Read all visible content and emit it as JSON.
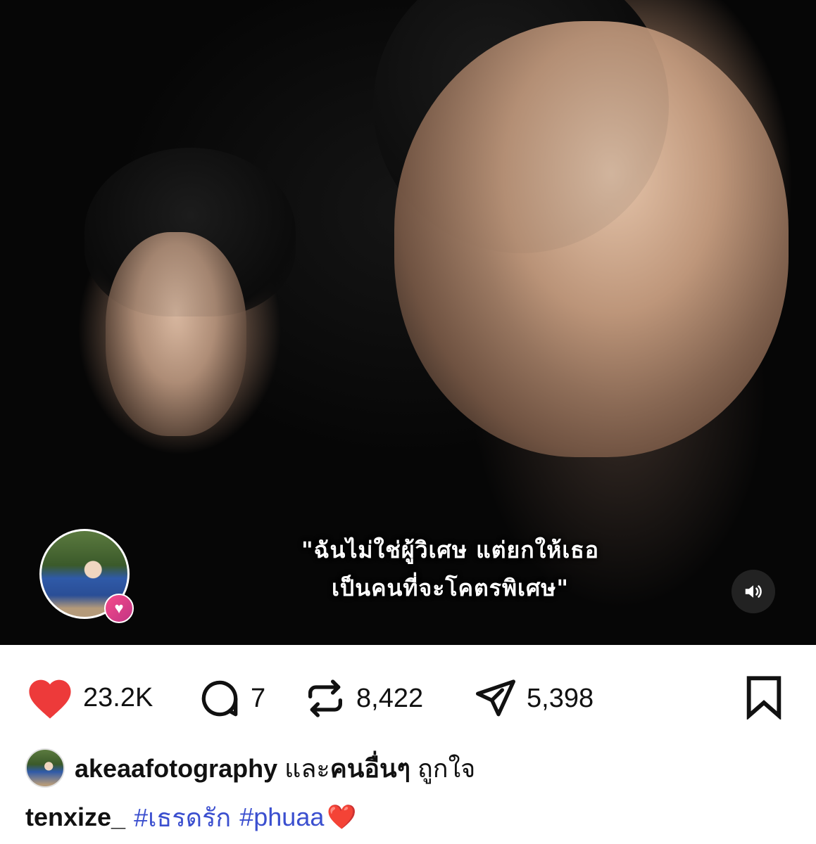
{
  "media": {
    "subtitle_line1": "\"ฉันไม่ใช่ผู้วิเศษ แต่ยกให้เธอ",
    "subtitle_line2": "เป็นคนที่จะโคตรพิเศษ\"",
    "sound_state": "unmuted"
  },
  "actions": {
    "likes": "23.2K",
    "comments": "7",
    "reposts": "8,422",
    "shares": "5,398",
    "like_color": "#ed3a3a"
  },
  "liked_by": {
    "username": "akeaafotography",
    "connector": "และ",
    "others": "คนอื่นๆ",
    "suffix": "ถูกใจ"
  },
  "caption": {
    "username": "tenxize_",
    "hashtags": [
      "#เธรดรัก",
      "#phuaa"
    ],
    "emoji": "❤️",
    "hashtag_color": "#3b4fcf"
  }
}
